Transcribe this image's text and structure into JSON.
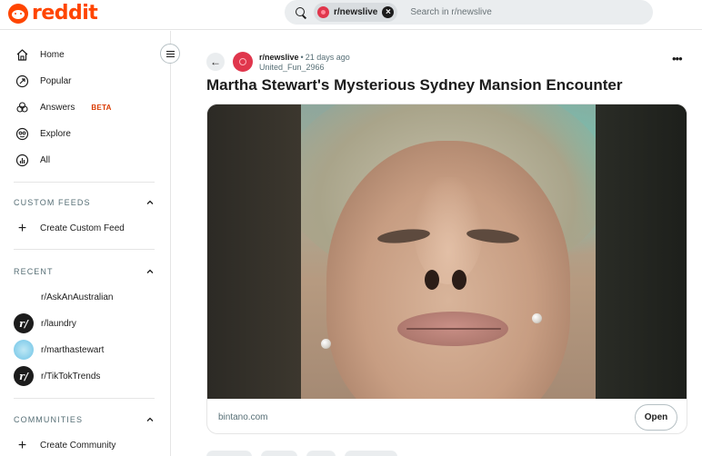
{
  "header": {
    "logo_text": "reddit",
    "search": {
      "chip_label": "r/newslive",
      "chip_close": "×",
      "placeholder": "Search in r/newslive"
    }
  },
  "sidebar": {
    "nav": [
      {
        "label": "Home",
        "icon": "home-icon"
      },
      {
        "label": "Popular",
        "icon": "popular-icon"
      },
      {
        "label": "Answers",
        "icon": "answers-icon",
        "badge": "BETA"
      },
      {
        "label": "Explore",
        "icon": "explore-icon"
      },
      {
        "label": "All",
        "icon": "all-icon"
      }
    ],
    "custom_feeds": {
      "title": "CUSTOM FEEDS",
      "create_label": "Create Custom Feed"
    },
    "recent": {
      "title": "RECENT",
      "items": [
        {
          "label": "r/AskAnAustralian"
        },
        {
          "label": "r/laundry"
        },
        {
          "label": "r/marthastewart"
        },
        {
          "label": "r/TikTokTrends"
        }
      ]
    },
    "communities": {
      "title": "COMMUNITIES",
      "create_label": "Create Community"
    }
  },
  "post": {
    "back_glyph": "←",
    "subreddit": "r/newslive",
    "separator": "•",
    "time": "21 days ago",
    "author": "United_Fun_2966",
    "more_glyph": "•••",
    "title": "Martha Stewart's Mysterious Sydney Mansion Encounter",
    "link_domain": "bintano.com",
    "open_label": "Open"
  },
  "colors": {
    "brand": "#ff4500",
    "beta": "#d93a00",
    "subreddit_avatar": "#e0364c"
  }
}
